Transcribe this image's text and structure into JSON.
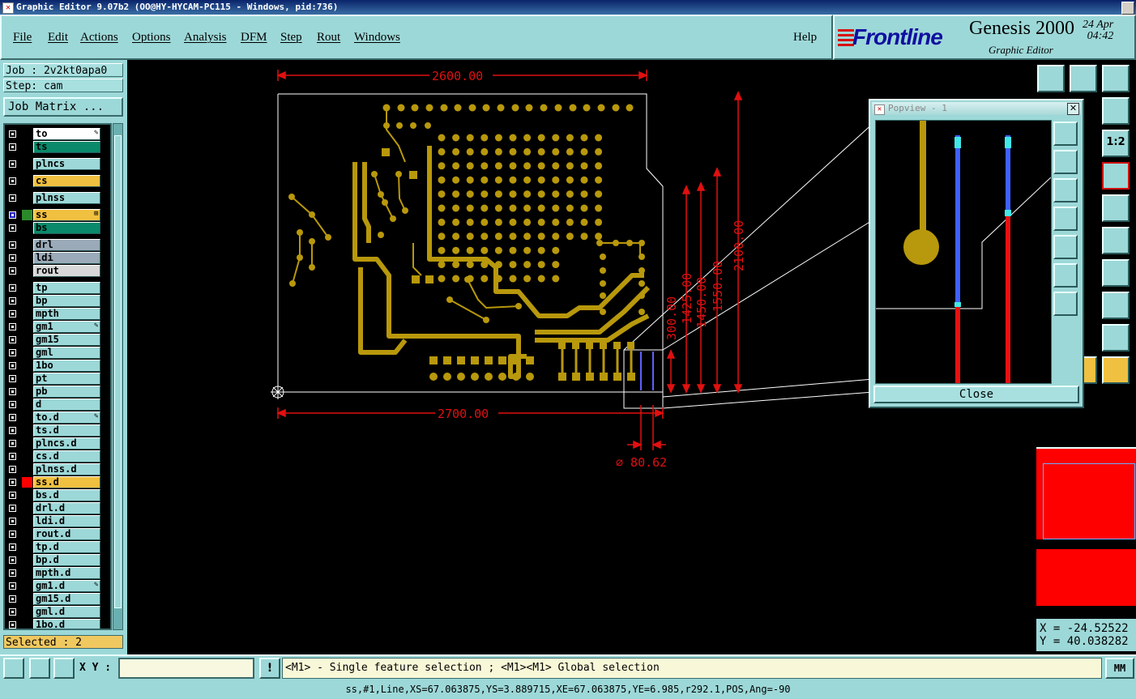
{
  "window": {
    "title": "Graphic Editor 9.07b2 (OO@HY-HYCAM-PC115 - Windows, pid:736)"
  },
  "menu": [
    "File",
    "Edit",
    "Actions",
    "Options",
    "Analysis",
    "DFM",
    "Step",
    "Rout",
    "Windows"
  ],
  "help_label": "Help",
  "brand": {
    "logo": "Frontline",
    "product": "Genesis 2000",
    "subtitle": "Graphic Editor",
    "date": "24 Apr\n04:42"
  },
  "job": {
    "job_line": "Job : 2v2kt0apa0",
    "step_line": "Step: cam",
    "matrix_button": "Job Matrix ..."
  },
  "layers": [
    {
      "name": "to",
      "bg": "#ffffff",
      "group": 0,
      "mark": "✎"
    },
    {
      "name": "ts",
      "bg": "#0a8a6a",
      "group": 0
    },
    {
      "name": "plncs",
      "bg": "#9dd8d8",
      "group": 1
    },
    {
      "name": "cs",
      "bg": "#f0c040",
      "group": 2
    },
    {
      "name": "plnss",
      "bg": "#9dd8d8",
      "group": 3
    },
    {
      "name": "ss",
      "bg": "#f0c040",
      "group": 4,
      "work": true,
      "mark": "⊞"
    },
    {
      "name": "bs",
      "bg": "#0a8a6a",
      "group": 4
    },
    {
      "name": "drl",
      "bg": "#9aaab8",
      "group": 5
    },
    {
      "name": "ldi",
      "bg": "#9aaab8",
      "group": 5
    },
    {
      "name": "rout",
      "bg": "#d8d8d8",
      "group": 5
    },
    {
      "name": "tp",
      "bg": "#9dd8d8",
      "group": 6
    },
    {
      "name": "bp",
      "bg": "#9dd8d8",
      "group": 6
    },
    {
      "name": "mpth",
      "bg": "#9dd8d8",
      "group": 6
    },
    {
      "name": "gm1",
      "bg": "#9dd8d8",
      "group": 6,
      "mark": "✎"
    },
    {
      "name": "gm15",
      "bg": "#9dd8d8",
      "group": 6
    },
    {
      "name": "gml",
      "bg": "#9dd8d8",
      "group": 6
    },
    {
      "name": "1bo",
      "bg": "#9dd8d8",
      "group": 6
    },
    {
      "name": "pt",
      "bg": "#9dd8d8",
      "group": 6
    },
    {
      "name": "pb",
      "bg": "#9dd8d8",
      "group": 6
    },
    {
      "name": "d",
      "bg": "#9dd8d8",
      "group": 6
    },
    {
      "name": "to.d",
      "bg": "#9dd8d8",
      "group": 6,
      "mark": "✎"
    },
    {
      "name": "ts.d",
      "bg": "#9dd8d8",
      "group": 6
    },
    {
      "name": "plncs.d",
      "bg": "#9dd8d8",
      "group": 6
    },
    {
      "name": "cs.d",
      "bg": "#9dd8d8",
      "group": 6
    },
    {
      "name": "plnss.d",
      "bg": "#9dd8d8",
      "group": 6
    },
    {
      "name": "ss.d",
      "bg": "#f0c040",
      "group": 6,
      "affected": true
    },
    {
      "name": "bs.d",
      "bg": "#9dd8d8",
      "group": 6
    },
    {
      "name": "drl.d",
      "bg": "#9dd8d8",
      "group": 6
    },
    {
      "name": "ldi.d",
      "bg": "#9dd8d8",
      "group": 6
    },
    {
      "name": "rout.d",
      "bg": "#9dd8d8",
      "group": 6
    },
    {
      "name": "tp.d",
      "bg": "#9dd8d8",
      "group": 6
    },
    {
      "name": "bp.d",
      "bg": "#9dd8d8",
      "group": 6
    },
    {
      "name": "mpth.d",
      "bg": "#9dd8d8",
      "group": 6
    },
    {
      "name": "gm1.d",
      "bg": "#9dd8d8",
      "group": 6,
      "mark": "✎"
    },
    {
      "name": "gm15.d",
      "bg": "#9dd8d8",
      "group": 6
    },
    {
      "name": "gml.d",
      "bg": "#9dd8d8",
      "group": 6
    },
    {
      "name": "1bo.d",
      "bg": "#9dd8d8",
      "group": 6
    }
  ],
  "selected_label": "Selected : 2",
  "dimensions": {
    "width_top": "2600.00",
    "width_bottom": "2700.00",
    "h1": "300.00",
    "h2": "1425.00",
    "h3": "1450.00",
    "h4": "1550.00",
    "h5": "2100.00",
    "diameter": "⌀ 80.62"
  },
  "popview": {
    "title": "Popview - 1",
    "close_label": "Close"
  },
  "coords": {
    "x": "X = -24.52522",
    "y": "Y = 40.038282"
  },
  "bottom": {
    "xy_label": "X Y :",
    "xy_value": "",
    "prompt": "<M1> - Single feature selection ; <M1><M1> Global selection",
    "units": "MM"
  },
  "status": "ss,#1,Line,XS=67.063875,YS=3.889715,XE=67.063875,YE=6.985,r292.1,POS,Ang=-90",
  "colors": {
    "panel": "#9dd8d8",
    "trace": "#b8980c",
    "dimension": "#e01010",
    "canvas": "#000000"
  }
}
